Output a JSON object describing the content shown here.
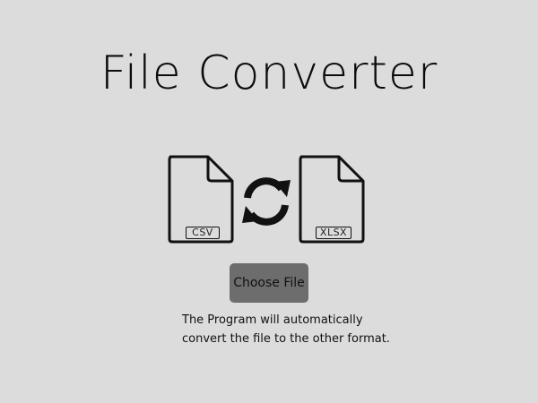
{
  "page": {
    "title": "File Converter",
    "background": "#dcdcdc"
  },
  "converter": {
    "source_format": "CSV",
    "target_format": "XLSX",
    "source_icon": "file-icon",
    "target_icon": "file-icon",
    "swap_icon": "sync-arrows-icon"
  },
  "upload": {
    "button_label": "Choose File",
    "button_color": "#6d6d6d"
  },
  "info": {
    "line1": "The Program will automatically",
    "line2": "convert the file to the other format."
  }
}
